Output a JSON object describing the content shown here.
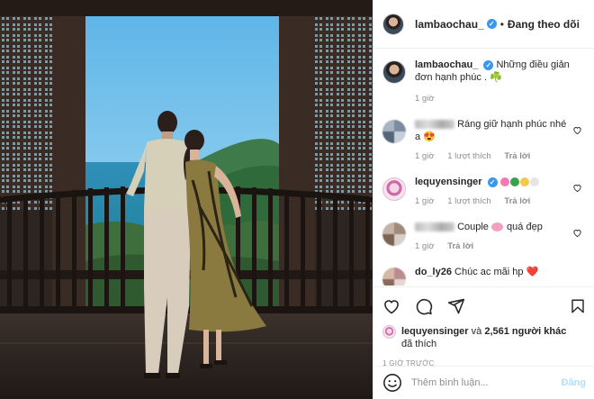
{
  "post": {
    "author": "lambaochau_",
    "follow_state": "Đang theo dõi",
    "separator": "•"
  },
  "caption": {
    "username": "lambaochau_",
    "text": "Những điều giản đơn hạnh phúc .",
    "emoji": "☘️",
    "time": "1 giờ"
  },
  "comments": [
    {
      "username": "",
      "text": "Ráng giữ hạnh phúc nhé a",
      "emoji": "😍",
      "time": "1 giờ",
      "likes": "1 lượt thích",
      "reply": "Trả lời"
    },
    {
      "username": "lequyensinger",
      "text": "",
      "time": "1 giờ",
      "likes": "1 lượt thích",
      "reply": "Trả lời"
    },
    {
      "username": "",
      "text": "Couple",
      "text_after": "quá đẹp",
      "time": "1 giờ",
      "reply": "Trả lời"
    },
    {
      "username": "do_ly26",
      "text": "Chúc ac mãi hp",
      "emoji": "❤️"
    }
  ],
  "likes": {
    "liker": "lequyensinger",
    "joiner": "và",
    "others": "2,561 người khác",
    "suffix": "đã thích"
  },
  "timestamp": "1 GIỜ TRƯỚC",
  "composer": {
    "placeholder": "Thêm bình luận...",
    "post_label": "Đăng"
  },
  "colors": {
    "verified": "#3897f0",
    "post_disabled": "#b2dffc",
    "muted": "#8e8e8e"
  },
  "icons": [
    "verified-icon",
    "heart-icon",
    "comment-icon",
    "share-icon",
    "bookmark-icon",
    "emoji-icon"
  ]
}
